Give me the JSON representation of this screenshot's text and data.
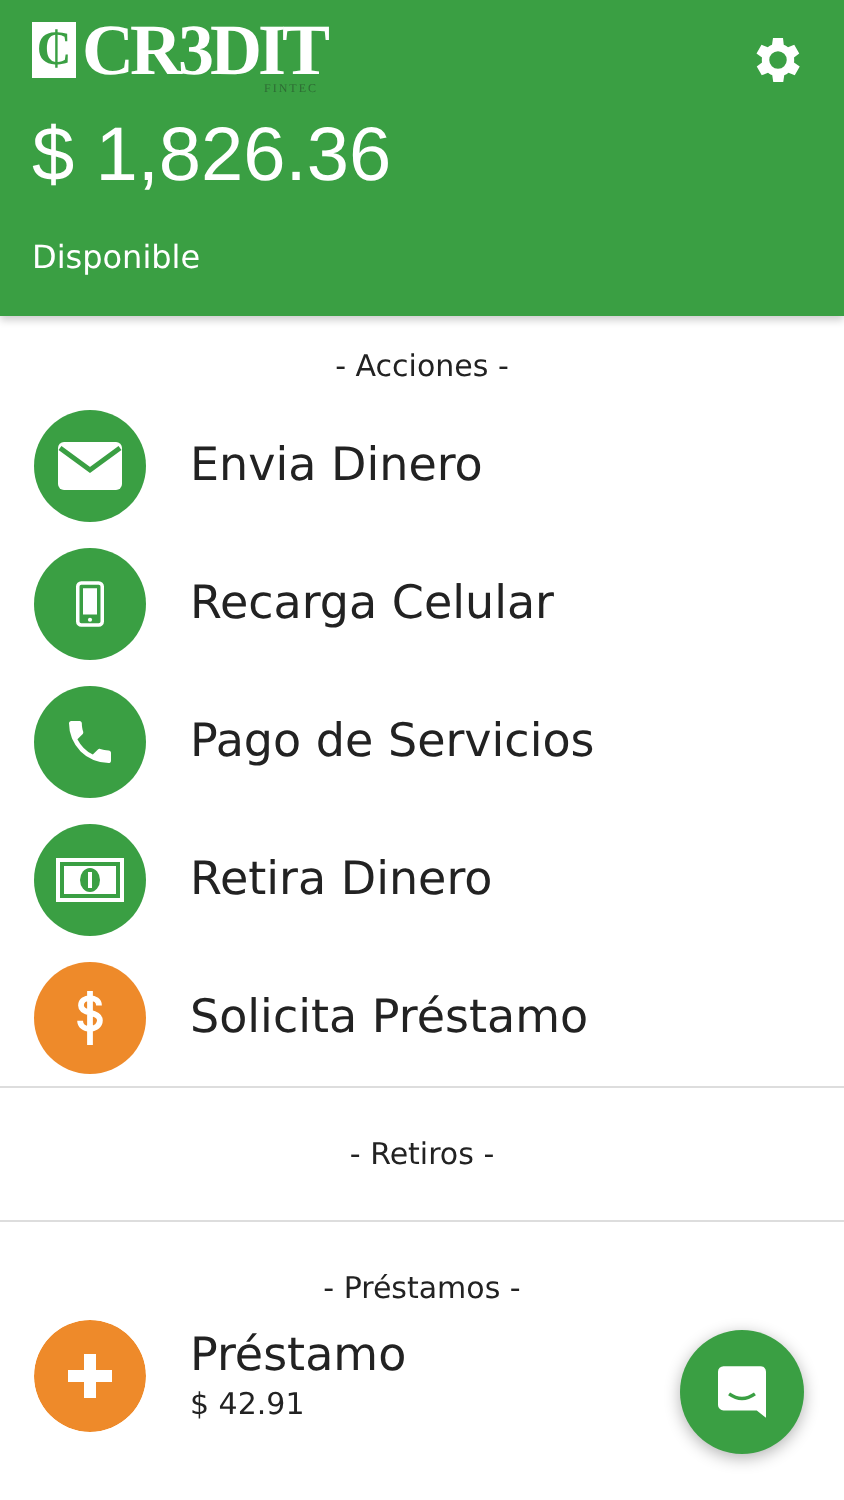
{
  "header": {
    "logo_mark": "₵",
    "logo_text": "CR3DIT",
    "logo_subtext": "FINTEC",
    "balance": "$ 1,826.36",
    "balance_label": "Disponible"
  },
  "actions_heading": "- Acciones -",
  "actions": [
    {
      "label": "Envia Dinero",
      "kind": "mail",
      "color": "#3a9f43"
    },
    {
      "label": "Recarga Celular",
      "kind": "mobile",
      "color": "#3a9f43"
    },
    {
      "label": "Pago de Servicios",
      "kind": "phone",
      "color": "#3a9f43"
    },
    {
      "label": "Retira Dinero",
      "kind": "cash",
      "color": "#3a9f43"
    },
    {
      "label": "Solicita Préstamo",
      "kind": "dollar",
      "color": "#ee8a2a"
    }
  ],
  "withdrawals_heading": "- Retiros -",
  "loans_heading": "- Préstamos -",
  "loans": [
    {
      "title": "Préstamo",
      "amount": "$ 42.91"
    }
  ]
}
